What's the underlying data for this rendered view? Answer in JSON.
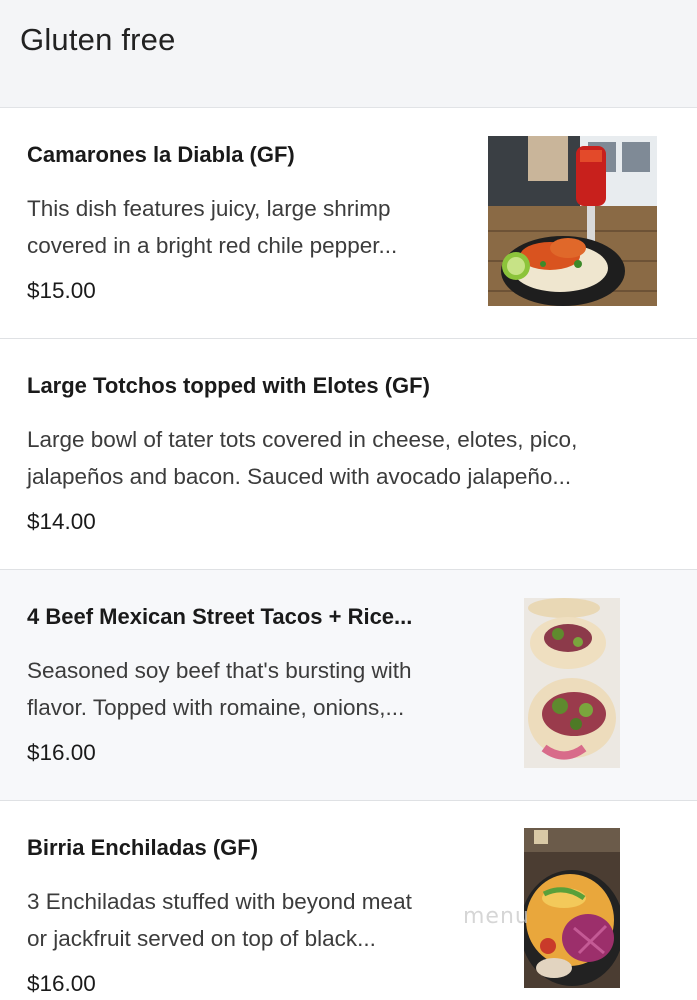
{
  "section": {
    "title": "Gluten free"
  },
  "items": [
    {
      "name": "Camarones la Diabla (GF)",
      "desc_line1": "This dish features juicy, large shrimp",
      "desc_line2": "covered in a bright red chile pepper...",
      "price": "$15.00"
    },
    {
      "name": "Large Totchos topped with Elotes (GF)",
      "desc_line1": "Large bowl of tater tots covered in cheese, elotes, pico,",
      "desc_line2": "jalapeños and bacon. Sauced with avocado jalapeño...",
      "price": "$14.00"
    },
    {
      "name": "4 Beef Mexican Street Tacos + Rice...",
      "desc_line1": "Seasoned soy beef that's bursting with",
      "desc_line2": "flavor. Topped with romaine, onions,...",
      "price": "$16.00"
    },
    {
      "name": "Birria Enchiladas (GF)",
      "desc_line1": "3 Enchiladas stuffed with beyond meat",
      "desc_line2": "or jackfruit served on top of black...",
      "price": "$16.00"
    }
  ],
  "watermark": "menu"
}
